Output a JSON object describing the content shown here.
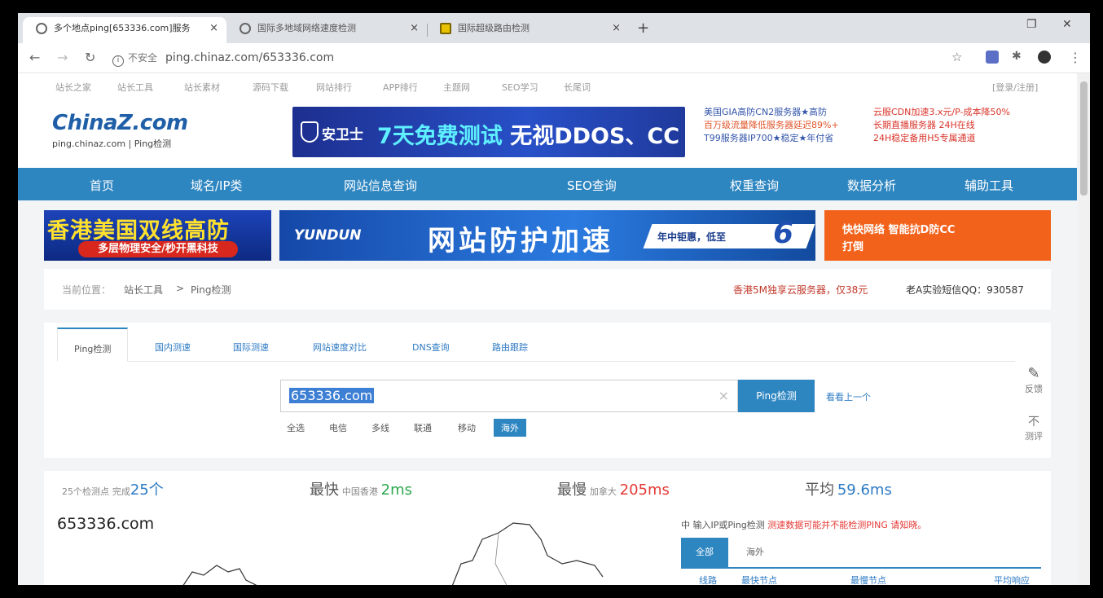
{
  "browser": {
    "tabs": [
      {
        "title": "多个地点ping[653336.com]服务",
        "close": "×"
      },
      {
        "title": "国际多地域网络速度检测",
        "close": "×"
      },
      {
        "title": "国际超级路由检测",
        "close": "×"
      }
    ],
    "new_tab": "+",
    "url_insecure": "不安全",
    "url": "ping.chinaz.com/653336.com"
  },
  "topbar": {
    "links": [
      "站长之家",
      "站长工具",
      "站长素材",
      "源码下载",
      "网站排行",
      "APP排行",
      "主题网",
      "SEO学习",
      "长尾词"
    ],
    "right": "[登录/注册]"
  },
  "header": {
    "logo_brand": "ChinaZ.com",
    "logo_sub": "ping.chinaz.com | Ping检测",
    "ad_brand": "安卫士",
    "ad_slogan_hi": "7天免费测试",
    "ad_slogan": "无视DDOS、CC",
    "ad_text_left": [
      "美国GIA高防CN2服务器★高防",
      "百万级流量降低服务器延迟89%+",
      "T99服务器IP700★稳定★年付省"
    ],
    "ad_text_right": [
      "云服CDN加速3.x元/P-成本降50%",
      "长期直播服务器 24H在线",
      "24H稳定备用H5专属通道"
    ]
  },
  "nav": [
    "首页",
    "域名/IP类",
    "网站信息查询",
    "SEO查询",
    "权重查询",
    "数据分析",
    "辅助工具"
  ],
  "ads": {
    "hk_title": "香港美国双线高防",
    "hk_sub": "多层物理安全/秒开黑科技",
    "yd_logo": "YUNDUN",
    "yd_big": "网站防护加速",
    "yd_tag": "年中钜惠，低至",
    "yd_six": "6",
    "or_a": "快快网络  智能抗D防CC",
    "or_b": "打倒"
  },
  "crumbs": {
    "pos": "当前位置：",
    "c1": "站长工具",
    "sep": ">",
    "c2": "Ping检测",
    "promo": "香港5M独享云服务器，仅38元",
    "qq": "老A实验短信QQ：930587"
  },
  "tool": {
    "tabs": [
      "Ping检测",
      "国内测速",
      "国际测速",
      "网站速度对比",
      "DNS查询",
      "路由跟踪"
    ],
    "search_value": "653336.com",
    "clear": "×",
    "button": "Ping检测",
    "last": "看看上一个",
    "options": [
      "全选",
      "电信",
      "多线",
      "联通",
      "移动",
      "海外"
    ],
    "side": {
      "feedback": "反馈",
      "icon2": "不",
      "compare": "测评"
    }
  },
  "results": {
    "nodes_label": "25个检测点",
    "nodes_done": "完成",
    "nodes_count": "25个",
    "fastest_label": "最快",
    "fastest_loc": "中国香港",
    "fastest_val": "2ms",
    "slowest_label": "最慢",
    "slowest_loc": "加拿大",
    "slowest_val": "205ms",
    "avg_label": "平均",
    "avg_val": "59.6ms",
    "domain": "653336.com",
    "tip": "中  输入IP或Ping检测",
    "tip_warn": "测速数据可能并不能检测PING  请知晓。",
    "rtabs": [
      "全部",
      "海外"
    ],
    "rhead": [
      "线路",
      "最快节点",
      "最慢节点",
      "平均响应"
    ]
  },
  "colors": {
    "accent": "#2e86c1",
    "slowest": "#e53935",
    "fastest": "#2fa84f",
    "avg": "#2e7bc4"
  }
}
